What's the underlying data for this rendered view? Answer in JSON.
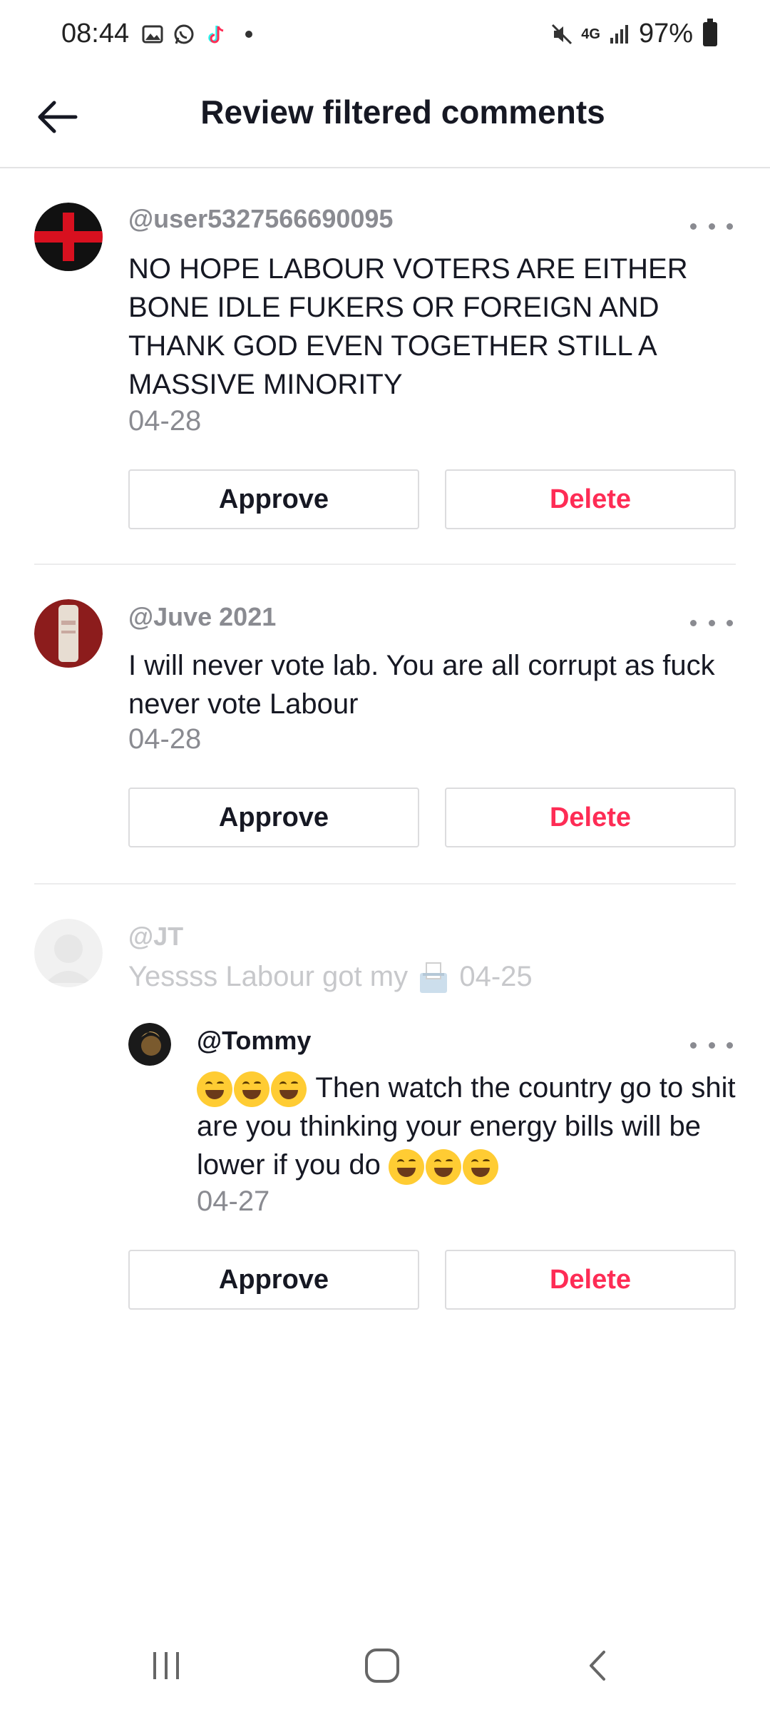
{
  "status_bar": {
    "time": "08:44",
    "network": "4G",
    "battery": "97%",
    "icons": [
      "gallery-icon",
      "whatsapp-icon",
      "tiktok-icon",
      "mute-icon",
      "signal-icon",
      "battery-icon"
    ]
  },
  "header": {
    "title": "Review filtered comments",
    "back_icon": "arrow-left-icon"
  },
  "comments": [
    {
      "username": "@user5327566690095",
      "text": "NO HOPE LABOUR VOTERS ARE EITHER BONE IDLE FUKERS OR FOREIGN AND THANK GOD EVEN TOGETHER STILL A MASSIVE MINORITY",
      "date": "04-28",
      "approve_label": "Approve",
      "delete_label": "Delete"
    },
    {
      "username": "@Juve 2021",
      "text": "I will never vote lab. You are all corrupt as fuck never vote Labour",
      "date": "04-28",
      "approve_label": "Approve",
      "delete_label": "Delete"
    }
  ],
  "parent_comment": {
    "username": "@JT",
    "text": "Yessss Labour got my",
    "date": "04-25"
  },
  "reply": {
    "username": "@Tommy",
    "text": "Then watch the country go to shit are you thinking your energy bills will be lower if you do",
    "date": "04-27",
    "approve_label": "Approve",
    "delete_label": "Delete"
  },
  "colors": {
    "accent_delete": "#fe2c55",
    "text_primary": "#161823",
    "text_secondary": "#8a8b91"
  }
}
